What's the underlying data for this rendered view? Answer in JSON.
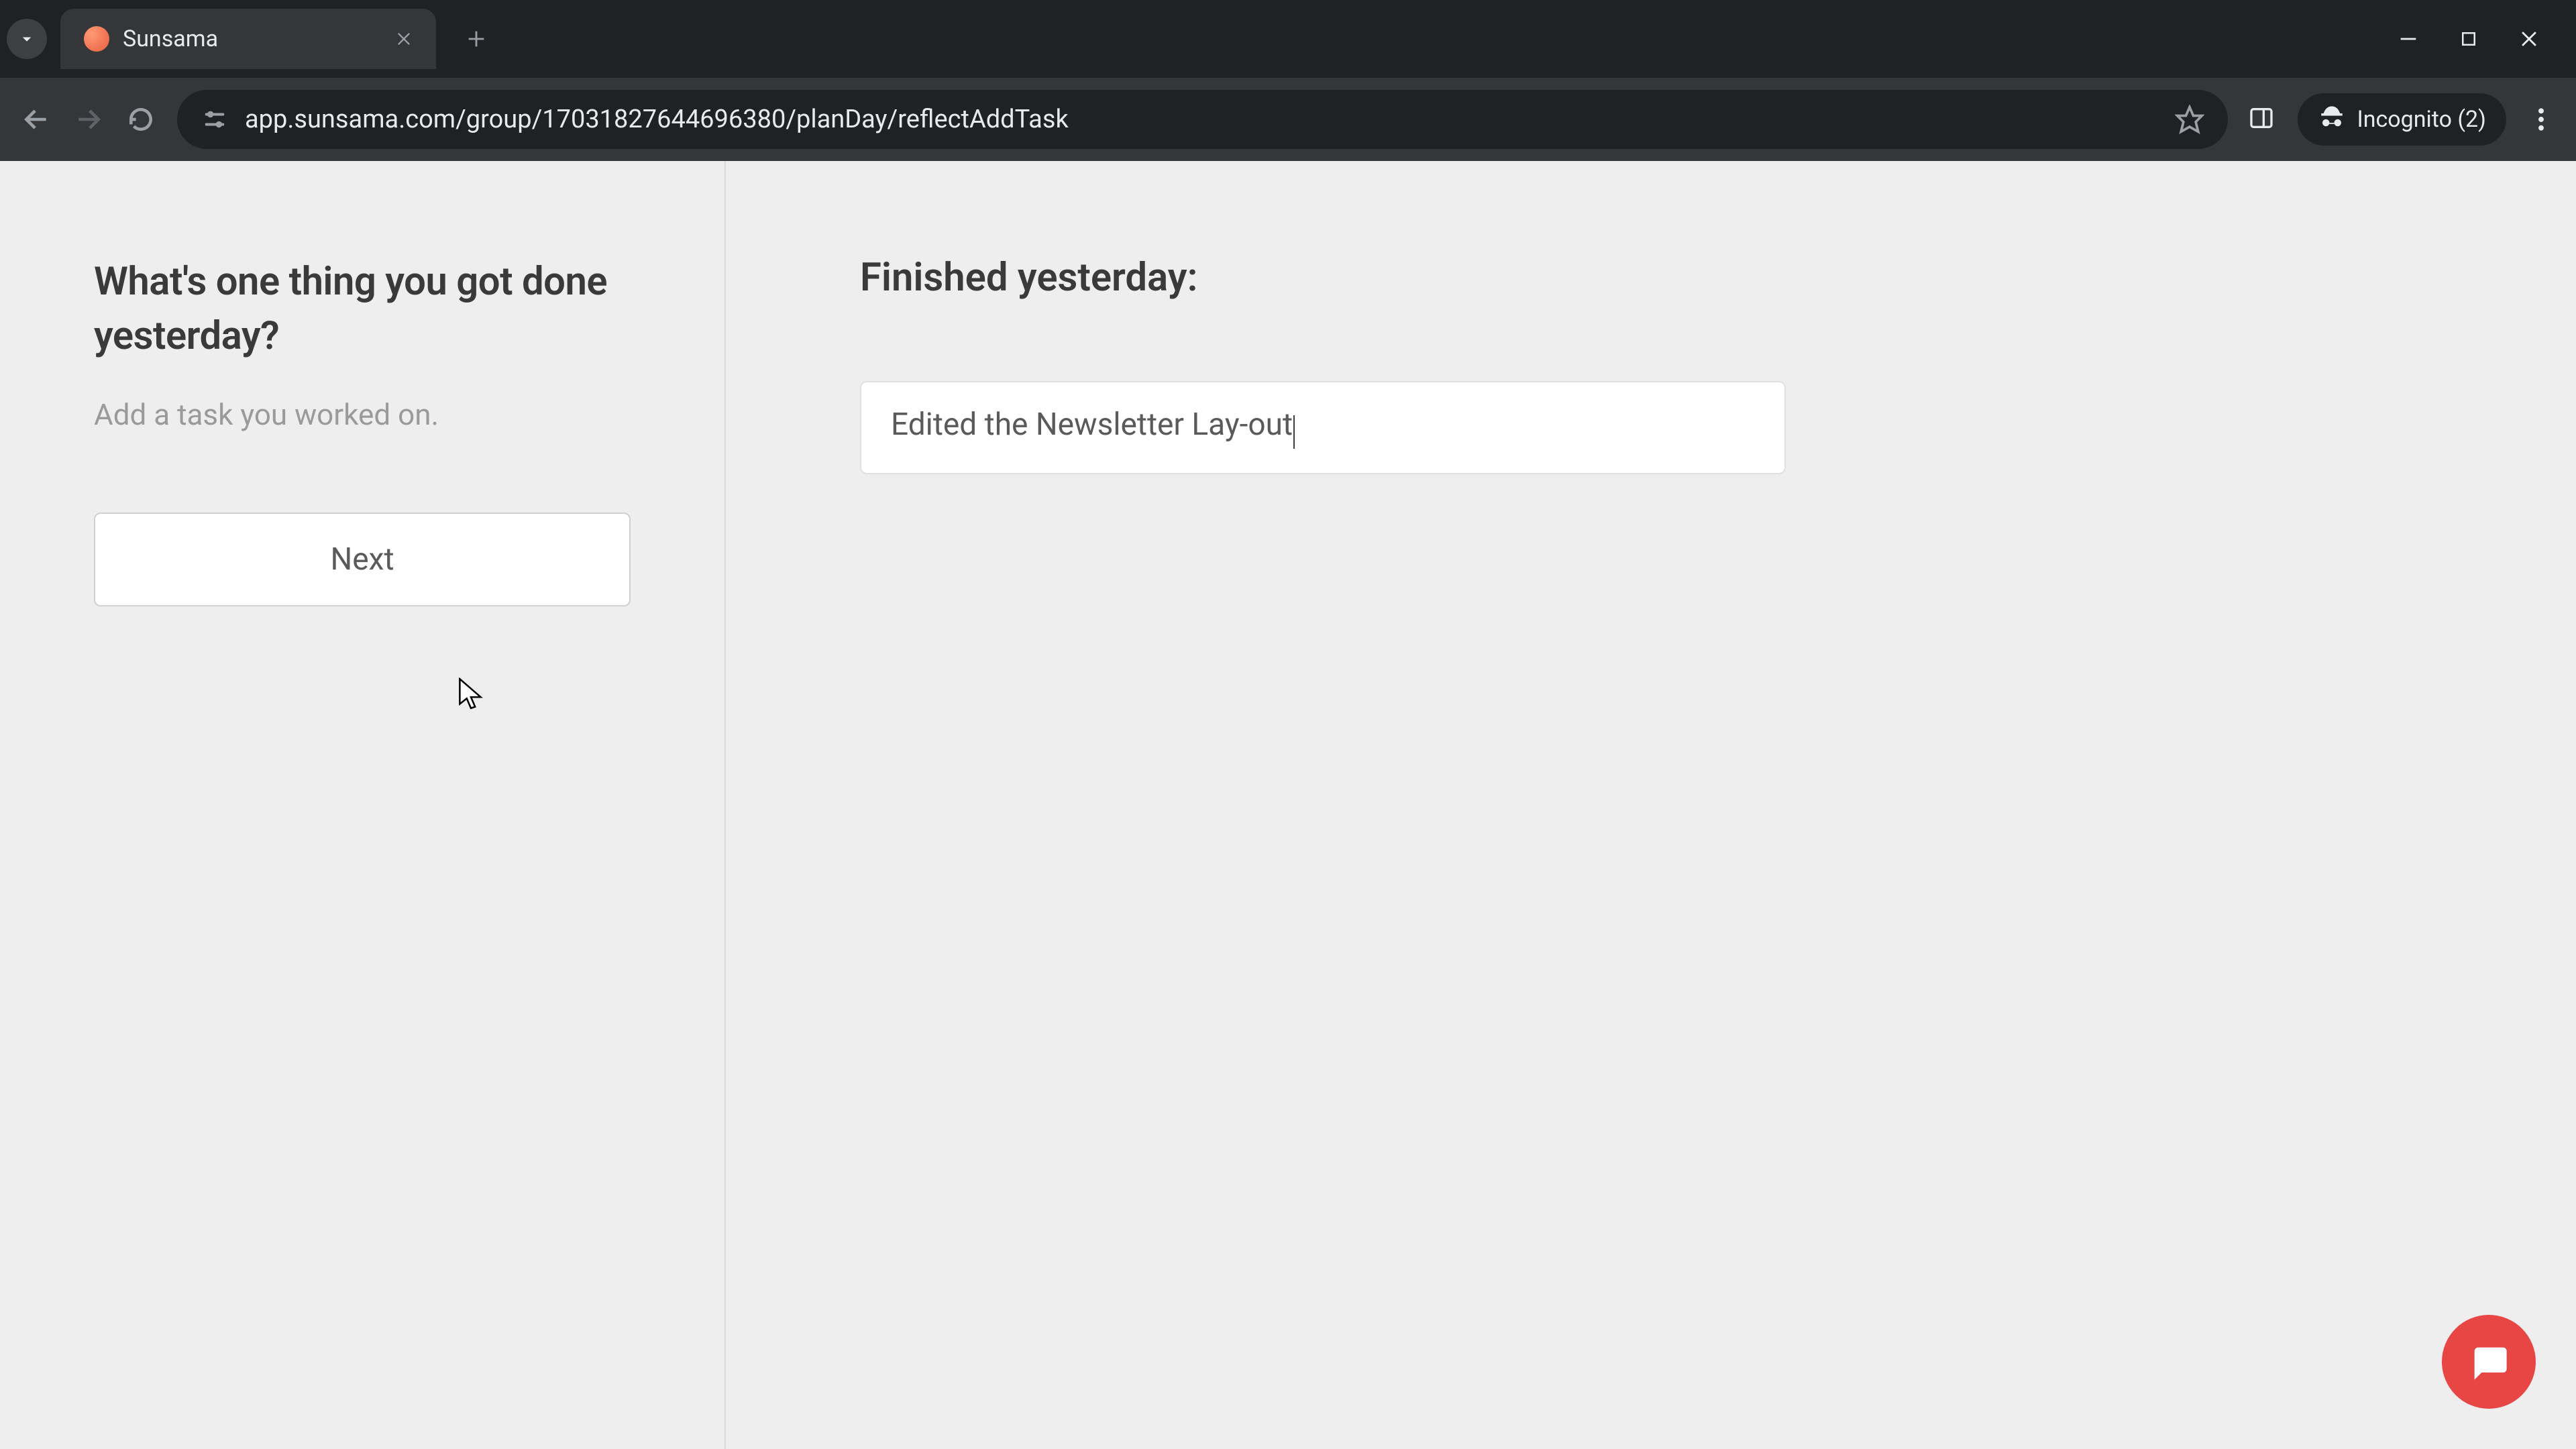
{
  "browser": {
    "tab": {
      "title": "Sunsama"
    },
    "url": "app.sunsama.com/group/17031827644696380/planDay/reflectAddTask",
    "incognito_label": "Incognito (2)"
  },
  "sidebar": {
    "heading": "What's one thing you got done yesterday?",
    "subtitle": "Add a task you worked on.",
    "next_button_label": "Next"
  },
  "main": {
    "heading": "Finished yesterday:",
    "task_input_value": "Edited the Newsletter Lay-out"
  }
}
